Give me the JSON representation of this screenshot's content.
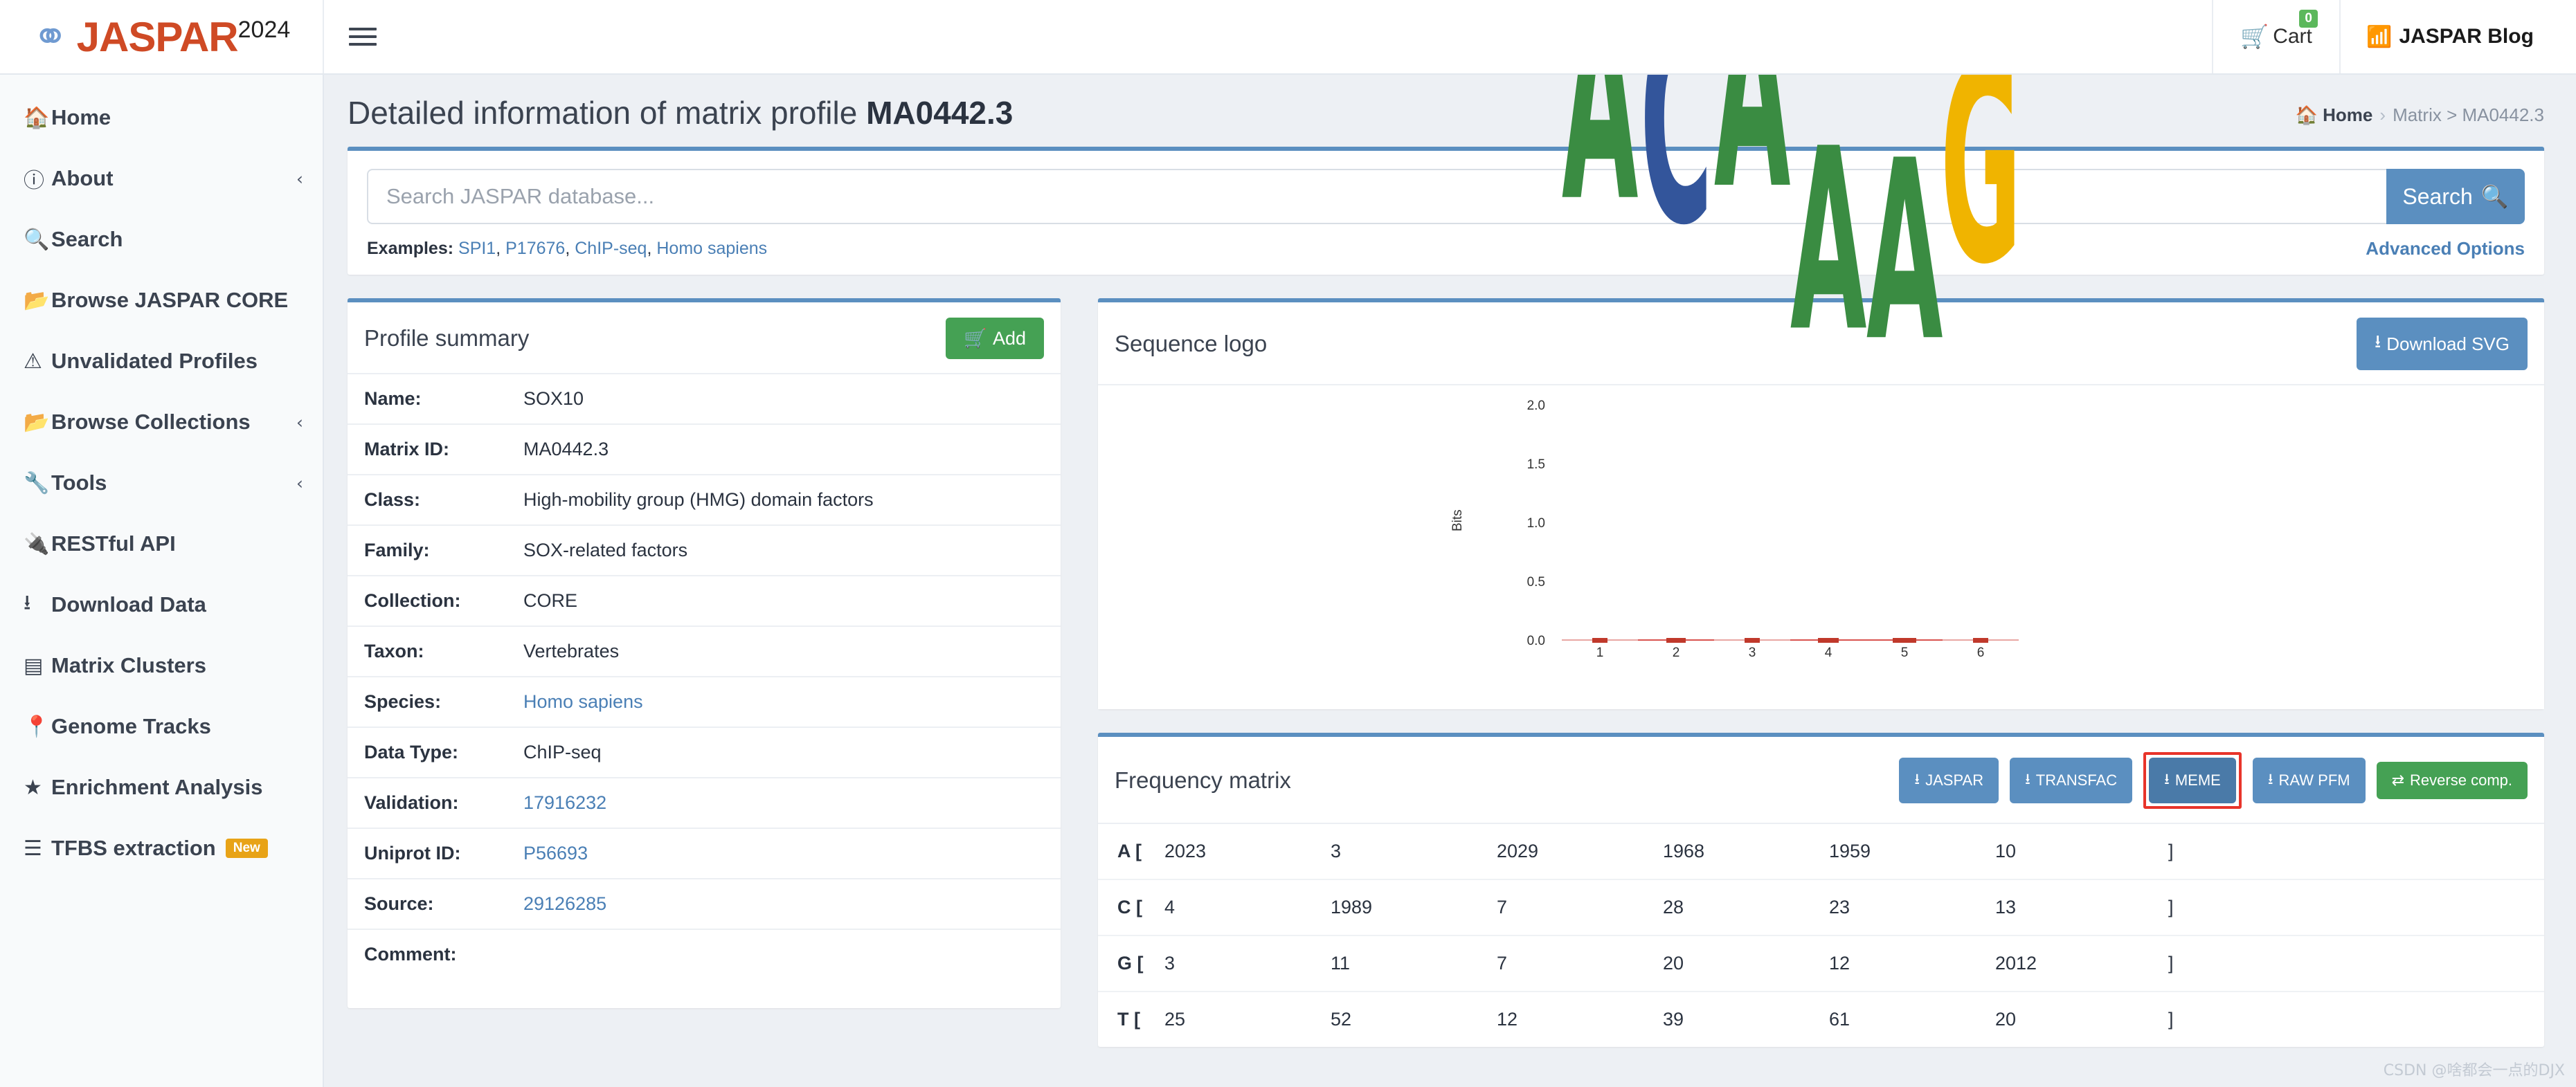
{
  "header": {
    "brand_icon": "open-access-icon",
    "brand_name": "JASPAR",
    "brand_year": "2024",
    "menu_toggle_icon": "hamburger-icon",
    "cart_label": "Cart",
    "cart_count": "0",
    "cart_icon": "shopping-cart-icon",
    "blog_label": "JASPAR Blog",
    "blog_icon": "rss-feed-icon"
  },
  "sidebar": {
    "items": [
      {
        "label": "Home",
        "icon": "home-icon",
        "chevron": "",
        "badge": ""
      },
      {
        "label": "About",
        "icon": "info-circle-icon",
        "chevron": "‹",
        "badge": ""
      },
      {
        "label": "Search",
        "icon": "search-icon",
        "chevron": "",
        "badge": ""
      },
      {
        "label": "Browse JASPAR CORE",
        "icon": "folder-open-icon",
        "chevron": "",
        "badge": ""
      },
      {
        "label": "Unvalidated Profiles",
        "icon": "warning-triangle-icon",
        "chevron": "",
        "badge": ""
      },
      {
        "label": "Browse Collections",
        "icon": "folder-open-icon",
        "chevron": "‹",
        "badge": ""
      },
      {
        "label": "Tools",
        "icon": "wrench-icon",
        "chevron": "‹",
        "badge": ""
      },
      {
        "label": "RESTful API",
        "icon": "plug-icon",
        "chevron": "",
        "badge": ""
      },
      {
        "label": "Download Data",
        "icon": "download-icon",
        "chevron": "",
        "badge": ""
      },
      {
        "label": "Matrix Clusters",
        "icon": "matrix-grid-icon",
        "chevron": "",
        "badge": ""
      },
      {
        "label": "Genome Tracks",
        "icon": "map-marker-icon",
        "chevron": "",
        "badge": ""
      },
      {
        "label": "Enrichment Analysis",
        "icon": "star-icon",
        "chevron": "",
        "badge": ""
      },
      {
        "label": "TFBS extraction",
        "icon": "list-lines-icon",
        "chevron": "",
        "badge": "New"
      }
    ]
  },
  "page": {
    "title_prefix": "Detailed information of matrix profile ",
    "title_id": "MA0442.3",
    "breadcrumb": {
      "home": "Home",
      "sep1": "›",
      "tail": "Matrix > MA0442.3"
    }
  },
  "search": {
    "placeholder": "Search JASPAR database...",
    "value": "",
    "button_label": "Search",
    "button_icon": "search-icon",
    "examples_label": "Examples:",
    "examples": [
      "SPI1",
      "P17676",
      "ChIP-seq",
      "Homo sapiens"
    ],
    "advanced_options": "Advanced Options"
  },
  "profile_summary": {
    "title": "Profile summary",
    "add_button": "Add",
    "add_icon": "cart-plus-icon",
    "rows": [
      {
        "key": "Name:",
        "value": "SOX10",
        "link": false
      },
      {
        "key": "Matrix ID:",
        "value": "MA0442.3",
        "link": false
      },
      {
        "key": "Class:",
        "value": "High-mobility group (HMG) domain factors",
        "link": false
      },
      {
        "key": "Family:",
        "value": "SOX-related factors",
        "link": false
      },
      {
        "key": "Collection:",
        "value": "CORE",
        "link": false
      },
      {
        "key": "Taxon:",
        "value": "Vertebrates",
        "link": false
      },
      {
        "key": "Species:",
        "value": "Homo sapiens",
        "link": true
      },
      {
        "key": "Data Type:",
        "value": "ChIP-seq",
        "link": false
      },
      {
        "key": "Validation:",
        "value": "17916232",
        "link": true
      },
      {
        "key": "Uniprot ID:",
        "value": "P56693",
        "link": true
      },
      {
        "key": "Source:",
        "value": "29126285",
        "link": true
      },
      {
        "key": "Comment:",
        "value": "",
        "link": false
      }
    ]
  },
  "sequence_logo": {
    "title": "Sequence logo",
    "download_button": "Download SVG",
    "download_icon": "download-icon"
  },
  "chart_data": {
    "type": "bar",
    "title": "Sequence logo",
    "xlabel": "",
    "ylabel": "Bits",
    "ylim": [
      0,
      2.0
    ],
    "yticks": [
      "0.0",
      "0.5",
      "1.0",
      "1.5",
      "2.0"
    ],
    "categories": [
      "1",
      "2",
      "3",
      "4",
      "5",
      "6"
    ],
    "stacks": [
      [
        {
          "base": "A",
          "bits": 1.86,
          "color": "#3a8c42"
        }
      ],
      [
        {
          "base": "C",
          "bits": 1.82,
          "color": "#33559b"
        }
      ],
      [
        {
          "base": "A",
          "bits": 1.88,
          "color": "#3a8c42"
        }
      ],
      [
        {
          "base": "A",
          "bits": 1.62,
          "color": "#3a8c42"
        }
      ],
      [
        {
          "base": "A",
          "bits": 1.6,
          "color": "#3a8c42"
        }
      ],
      [
        {
          "base": "G",
          "bits": 1.75,
          "color": "#f0b400"
        }
      ]
    ]
  },
  "frequency_matrix": {
    "title": "Frequency matrix",
    "buttons": [
      {
        "label": "JASPAR",
        "icon": "download-icon",
        "style": "blue",
        "active": false
      },
      {
        "label": "TRANSFAC",
        "icon": "download-icon",
        "style": "blue",
        "active": false
      },
      {
        "label": "MEME",
        "icon": "download-icon",
        "style": "blue",
        "active": true
      },
      {
        "label": "RAW PFM",
        "icon": "download-icon",
        "style": "blue",
        "active": false
      },
      {
        "label": "Reverse comp.",
        "icon": "exchange-arrows-icon",
        "style": "green",
        "active": false
      }
    ],
    "open_bracket": "[",
    "close_bracket": "]",
    "rows": [
      {
        "base": "A",
        "values": [
          "2023",
          "3",
          "2029",
          "1968",
          "1959",
          "10"
        ]
      },
      {
        "base": "C",
        "values": [
          "4",
          "1989",
          "7",
          "28",
          "23",
          "13"
        ]
      },
      {
        "base": "G",
        "values": [
          "3",
          "11",
          "7",
          "20",
          "12",
          "2012"
        ]
      },
      {
        "base": "T",
        "values": [
          "25",
          "52",
          "12",
          "39",
          "61",
          "20"
        ]
      }
    ]
  },
  "watermark": "CSDN @啥都会一点的DJX"
}
